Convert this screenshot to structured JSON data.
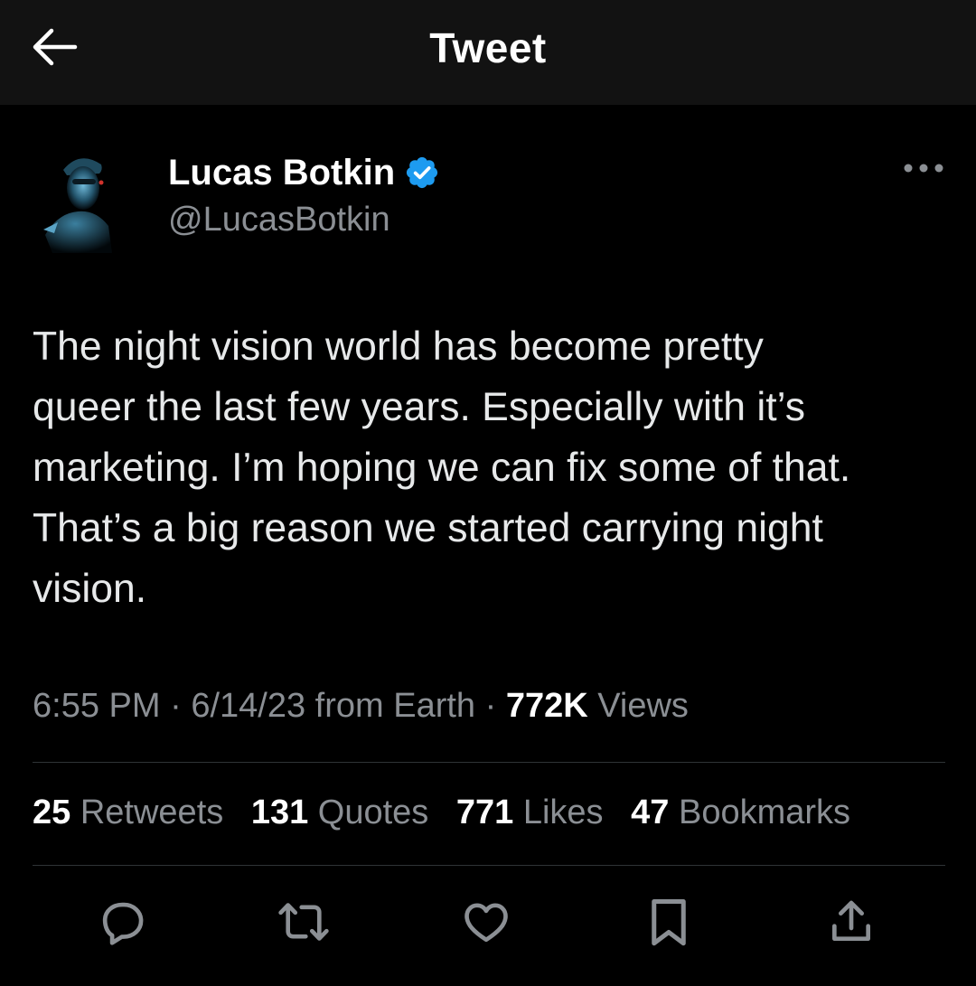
{
  "header": {
    "title": "Tweet",
    "back_icon": "arrow-left-icon"
  },
  "author": {
    "name": "Lucas Botkin",
    "handle": "@LucasBotkin",
    "verified_icon": "verified-badge-icon",
    "verified_color": "#1d9bf0"
  },
  "tweet": {
    "text": "The night vision world has become pretty\nqueer the last few years. Especially with it’s\nmarketing. I’m hoping we can fix some of that.\nThat’s a big reason we started carrying night\nvision.",
    "time": "6:55 PM",
    "date": "6/14/23",
    "source": "from Earth",
    "sep": "·",
    "views_count": "772K",
    "views_label": "Views"
  },
  "stats": {
    "retweets_count": "25",
    "retweets_label": "Retweets",
    "quotes_count": "131",
    "quotes_label": "Quotes",
    "likes_count": "771",
    "likes_label": "Likes",
    "bookmarks_count": "47",
    "bookmarks_label": "Bookmarks"
  },
  "actions": [
    {
      "icon": "reply-icon"
    },
    {
      "icon": "retweet-icon"
    },
    {
      "icon": "like-heart-icon"
    },
    {
      "icon": "bookmark-icon"
    },
    {
      "icon": "share-icon"
    }
  ],
  "colors": {
    "background": "#000000",
    "header_background": "#121212",
    "text_primary": "#e7e9ea",
    "text_secondary": "#8b8f94",
    "divider": "#2f3336",
    "accent": "#1d9bf0"
  }
}
